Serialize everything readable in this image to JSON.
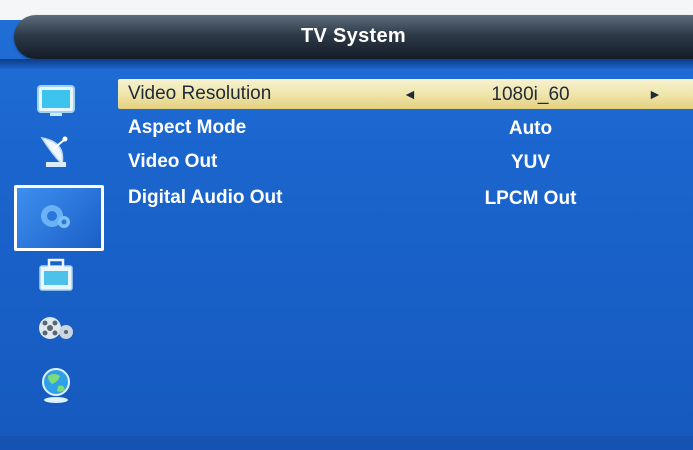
{
  "header": {
    "title": "TV System"
  },
  "sidebar": {
    "items": [
      {
        "icon": "tv-icon"
      },
      {
        "icon": "satellite-dish-icon"
      },
      {
        "icon": "gear-icon",
        "selected": true
      },
      {
        "icon": "toolbox-icon"
      },
      {
        "icon": "film-reel-icon"
      },
      {
        "icon": "globe-icon"
      }
    ]
  },
  "settings": [
    {
      "label": "Video Resolution",
      "value": "1080i_60",
      "selected": true,
      "left_arrow": "◄",
      "right_arrow": "►"
    },
    {
      "label": "Aspect Mode",
      "value": "Auto"
    },
    {
      "label": "Video Out",
      "value": "YUV"
    },
    {
      "label": "Digital Audio Out",
      "value": "LPCM Out"
    }
  ],
  "colors": {
    "background": "#1a64cc",
    "highlight": "#efe4a8",
    "title_bar": "#1e2a38",
    "text": "#ffffff"
  }
}
